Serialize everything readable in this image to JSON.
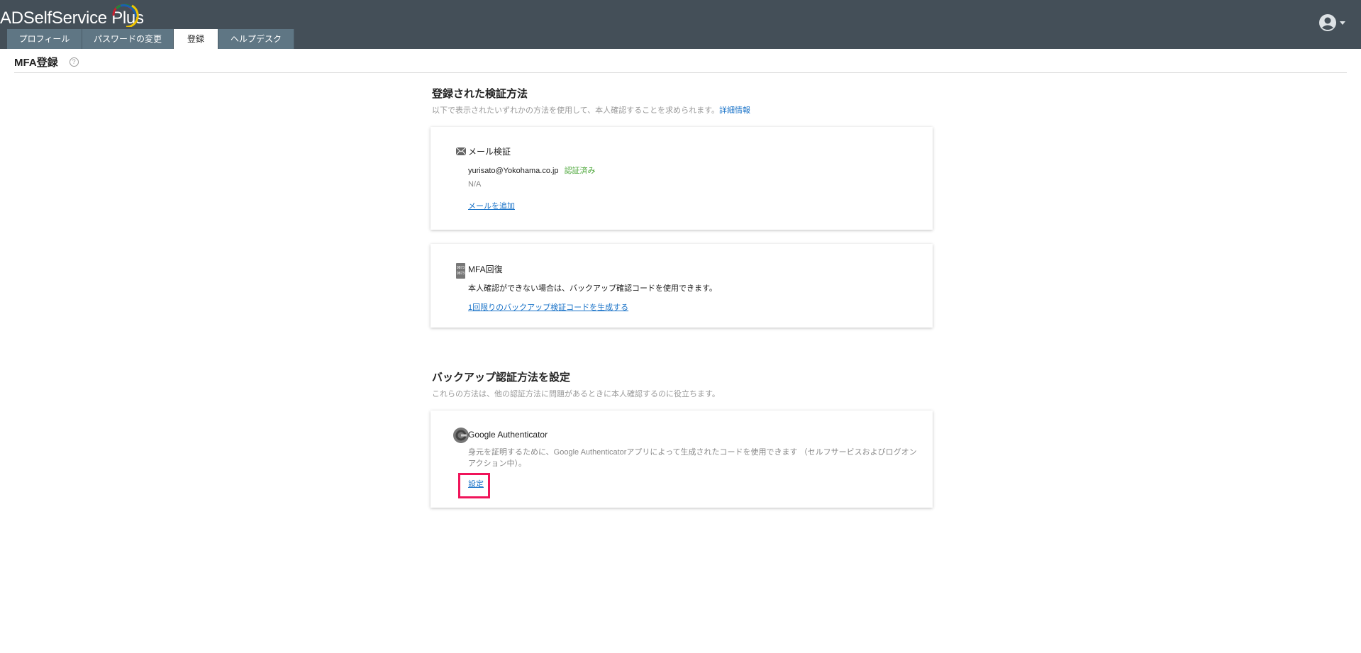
{
  "app": {
    "title": "ADSelfService Plus"
  },
  "tabs": [
    {
      "label": "プロフィール"
    },
    {
      "label": "パスワードの変更"
    },
    {
      "label": "登録"
    },
    {
      "label": "ヘルプデスク"
    }
  ],
  "page": {
    "title": "MFA登録",
    "help": "?"
  },
  "registered": {
    "heading": "登録された検証方法",
    "subtitle": "以下で表示されたいずれかの方法を使用して、本人確認することを求められます。",
    "more_link": "詳細情報",
    "email": {
      "title": "メール検証",
      "address": "yurisato@Yokohama.co.jp",
      "status": "認証済み",
      "secondary": "N/A",
      "add_link": "メールを追加"
    },
    "recovery": {
      "title": "MFA回復",
      "desc": "本人確認ができない場合は、バックアップ確認コードを使用できます。",
      "link": "1回限りのバックアップ検証コードを生成する",
      "icon_text": "9873"
    }
  },
  "backup": {
    "heading": "バックアップ認証方法を設定",
    "subtitle": "これらの方法は、他の認証方法に問題があるときに本人確認するのに役立ちます。",
    "google": {
      "title": "Google Authenticator",
      "desc": "身元を証明するために、Google Authenticatorアプリによって生成されたコードを使用できます （セルフサービスおよびログオンアクション中）。",
      "link": "設定"
    }
  },
  "colors": {
    "header": "#444f58",
    "tab": "#5f7684",
    "link": "#1a73c8",
    "verified": "#4aa637",
    "highlight": "#f0145a"
  }
}
